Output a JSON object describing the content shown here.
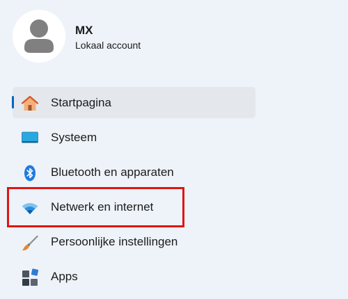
{
  "profile": {
    "name": "MX",
    "account_type": "Lokaal account"
  },
  "nav": {
    "items": [
      {
        "label": "Startpagina",
        "icon": "home-icon",
        "selected": true
      },
      {
        "label": "Systeem",
        "icon": "system-icon",
        "selected": false
      },
      {
        "label": "Bluetooth en apparaten",
        "icon": "bluetooth-icon",
        "selected": false
      },
      {
        "label": "Netwerk en internet",
        "icon": "wifi-icon",
        "selected": false,
        "annotated": true
      },
      {
        "label": "Persoonlijke instellingen",
        "icon": "brush-icon",
        "selected": false
      },
      {
        "label": "Apps",
        "icon": "apps-icon",
        "selected": false
      }
    ]
  },
  "colors": {
    "background": "#eef3f9",
    "selected_background": "#e4e8ed",
    "accent_indicator": "#0067c0",
    "annotation_border": "#e01414"
  }
}
